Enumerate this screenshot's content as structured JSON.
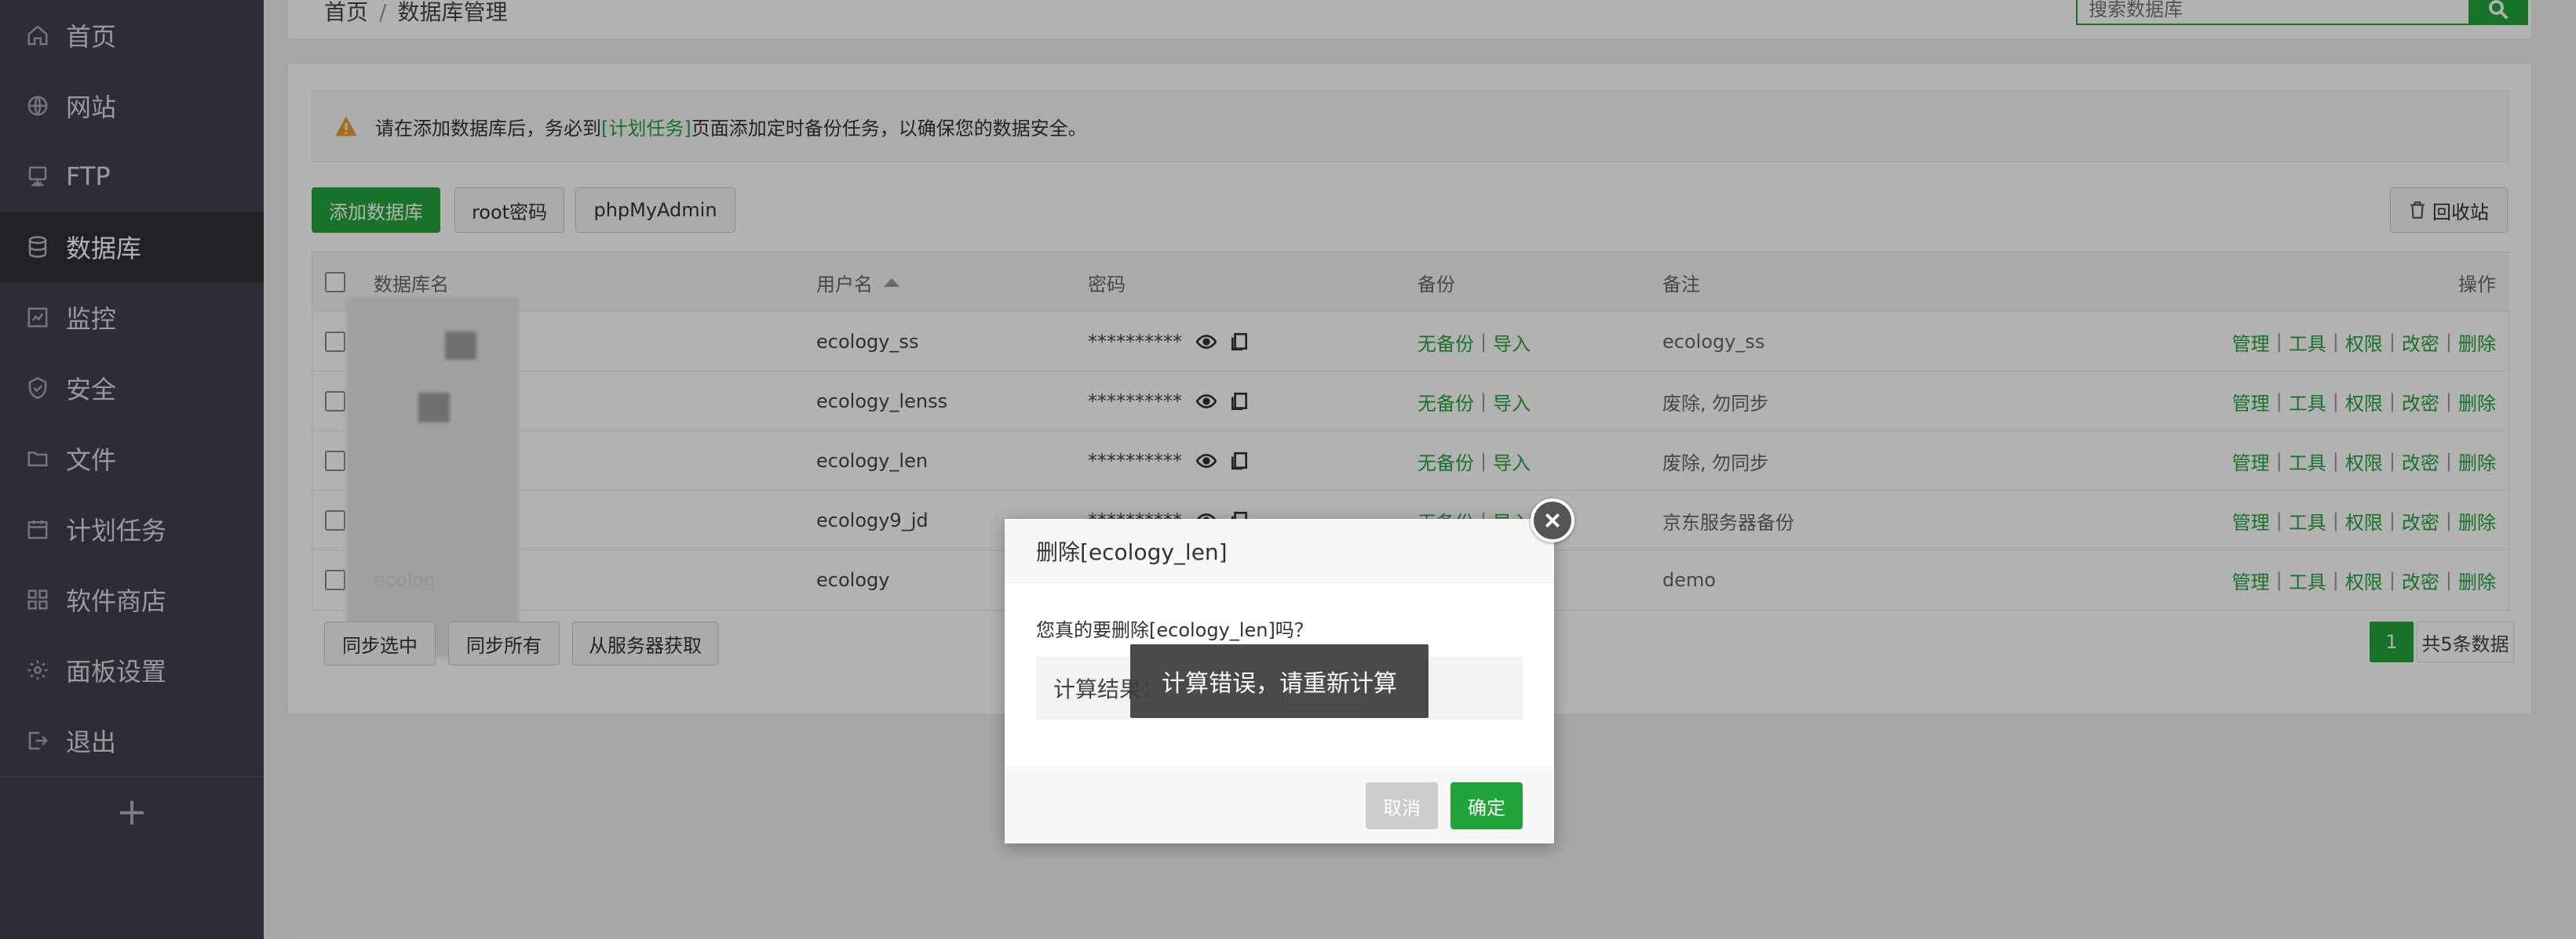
{
  "sidebar": {
    "items": [
      {
        "label": "首页",
        "icon": "home-icon"
      },
      {
        "label": "网站",
        "icon": "globe-icon"
      },
      {
        "label": "FTP",
        "icon": "ftp-icon"
      },
      {
        "label": "数据库",
        "icon": "database-icon",
        "active": true
      },
      {
        "label": "监控",
        "icon": "monitor-icon"
      },
      {
        "label": "安全",
        "icon": "shield-icon"
      },
      {
        "label": "文件",
        "icon": "folder-icon"
      },
      {
        "label": "计划任务",
        "icon": "calendar-icon"
      },
      {
        "label": "软件商店",
        "icon": "grid-icon"
      },
      {
        "label": "面板设置",
        "icon": "gear-icon"
      },
      {
        "label": "退出",
        "icon": "logout-icon"
      }
    ],
    "add_label": "+"
  },
  "breadcrumb": {
    "home": "首页",
    "sep": "/",
    "current": "数据库管理"
  },
  "search": {
    "placeholder": "搜索数据库"
  },
  "alert": {
    "before": "请在添加数据库后，务必到",
    "link": "[计划任务]",
    "after": "页面添加定时备份任务，以确保您的数据安全。"
  },
  "toolbar": {
    "add_db": "添加数据库",
    "root_pw": "root密码",
    "phpmyadmin": "phpMyAdmin",
    "recycle": "回收站"
  },
  "table": {
    "headers": {
      "name": "数据库名",
      "user": "用户名",
      "password": "密码",
      "backup": "备份",
      "note": "备注",
      "ops": "操作"
    },
    "backup_none": "无备份",
    "backup_import": "导入",
    "ops": [
      "管理",
      "工具",
      "权限",
      "改密",
      "删除"
    ],
    "rows": [
      {
        "name": "",
        "user": "ecology_ss",
        "password": "**********",
        "note": "ecology_ss"
      },
      {
        "name": "",
        "user": "ecology_lenss",
        "password": "**********",
        "note": "废除, 勿同步"
      },
      {
        "name": "",
        "user": "ecology_len",
        "password": "**********",
        "note": "废除, 勿同步"
      },
      {
        "name": "",
        "user": "ecology9_jd",
        "password": "**********",
        "note": "京东服务器备份"
      },
      {
        "name": "ecolog",
        "user": "ecology",
        "password": "",
        "note": "demo"
      }
    ]
  },
  "footer": {
    "sync_selected": "同步选中",
    "sync_all": "同步所有",
    "from_server": "从服务器获取",
    "page": "1",
    "total": "共5条数据"
  },
  "modal": {
    "title": "删除[ecology_len]",
    "question": "您真的要删除[ecology_len]吗？",
    "calc_label": "计算结果：",
    "cancel": "取消",
    "confirm": "确定"
  },
  "toast": {
    "message": "计算错误，请重新计算"
  },
  "colors": {
    "accent": "#20a53a",
    "sidebar": "#3c444d"
  }
}
